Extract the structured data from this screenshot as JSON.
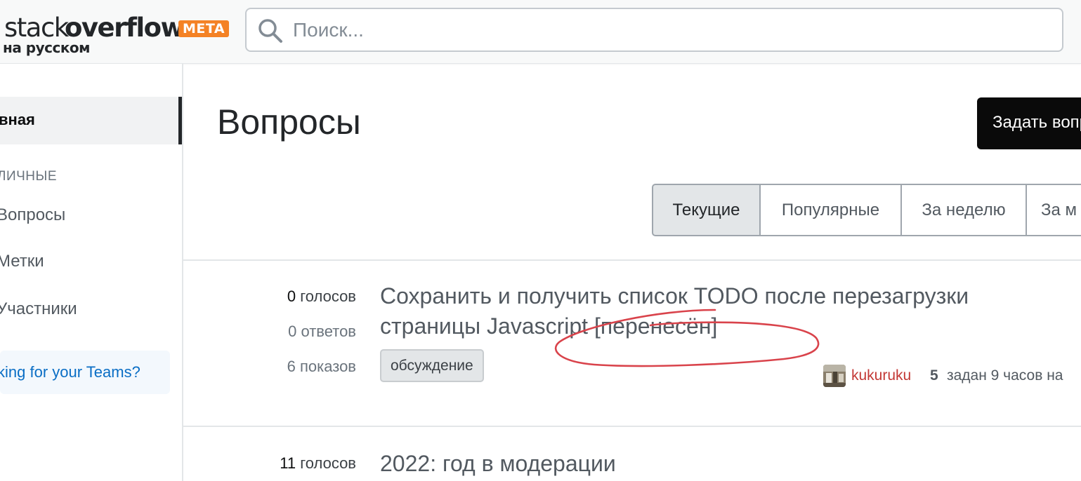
{
  "header": {
    "logo_stack": "stack",
    "logo_overflow": "overflow",
    "logo_badge": "META",
    "logo_sub": "на русском",
    "search_placeholder": "Поиск..."
  },
  "sidebar": {
    "home": "вная",
    "section": "ЛИЧНЫЕ",
    "items": [
      {
        "label": "Вопросы"
      },
      {
        "label": "Метки"
      },
      {
        "label": "Участники"
      }
    ],
    "teams_text": "king for your Teams?"
  },
  "main": {
    "title": "Вопросы",
    "ask_button": "Задать вопрос",
    "filters": [
      "Текущие",
      "Популярные",
      "За неделю",
      "За м"
    ]
  },
  "questions": [
    {
      "votes": "0",
      "votes_label": "голосов",
      "answers": "0",
      "answers_label": "ответов",
      "views": "6",
      "views_label": "показов",
      "title": "Сохранить и получить список TODO после перезагрузки страницы Javascript [перенесён]",
      "tag": "обсуждение",
      "user": "kukuruku",
      "rep": "5",
      "asked": "задан 9 часов на"
    },
    {
      "votes": "11",
      "votes_label": "голосов",
      "title": "2022: год в модерации"
    }
  ],
  "colors": {
    "accent_orange": "#f48225",
    "annotation_red": "#d9434b",
    "user_link": "#c33835"
  }
}
